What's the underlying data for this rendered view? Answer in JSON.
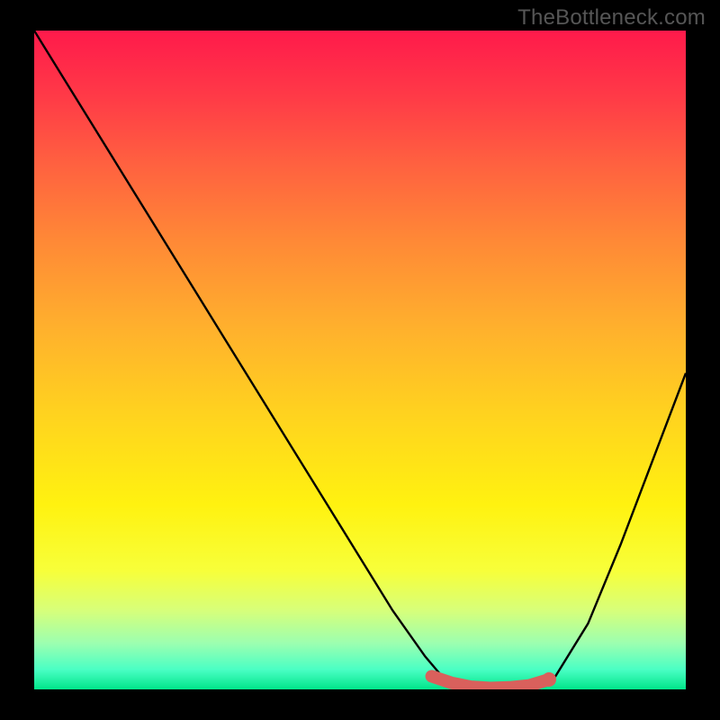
{
  "watermark": "TheBottleneck.com",
  "chart_data": {
    "type": "line",
    "title": "",
    "xlabel": "",
    "ylabel": "",
    "xlim": [
      0,
      100
    ],
    "ylim": [
      0,
      100
    ],
    "series": [
      {
        "name": "bottleneck-curve",
        "x": [
          0,
          5,
          10,
          15,
          20,
          25,
          30,
          35,
          40,
          45,
          50,
          55,
          60,
          63,
          66,
          70,
          74,
          78,
          80,
          85,
          90,
          95,
          100
        ],
        "values": [
          100,
          92,
          84,
          76,
          68,
          60,
          52,
          44,
          36,
          28,
          20,
          12,
          5,
          1.5,
          0.5,
          0.2,
          0.2,
          0.6,
          2,
          10,
          22,
          35,
          48
        ]
      }
    ],
    "highlight": {
      "name": "optimal-band",
      "x": [
        61,
        64,
        67,
        70,
        73,
        76,
        79
      ],
      "values": [
        2.0,
        1.0,
        0.4,
        0.2,
        0.3,
        0.6,
        1.5
      ]
    },
    "colors": {
      "curve": "#000000",
      "highlight": "#d9605c",
      "gradient_top": "#ff1a4b",
      "gradient_bottom": "#00e58a"
    }
  }
}
